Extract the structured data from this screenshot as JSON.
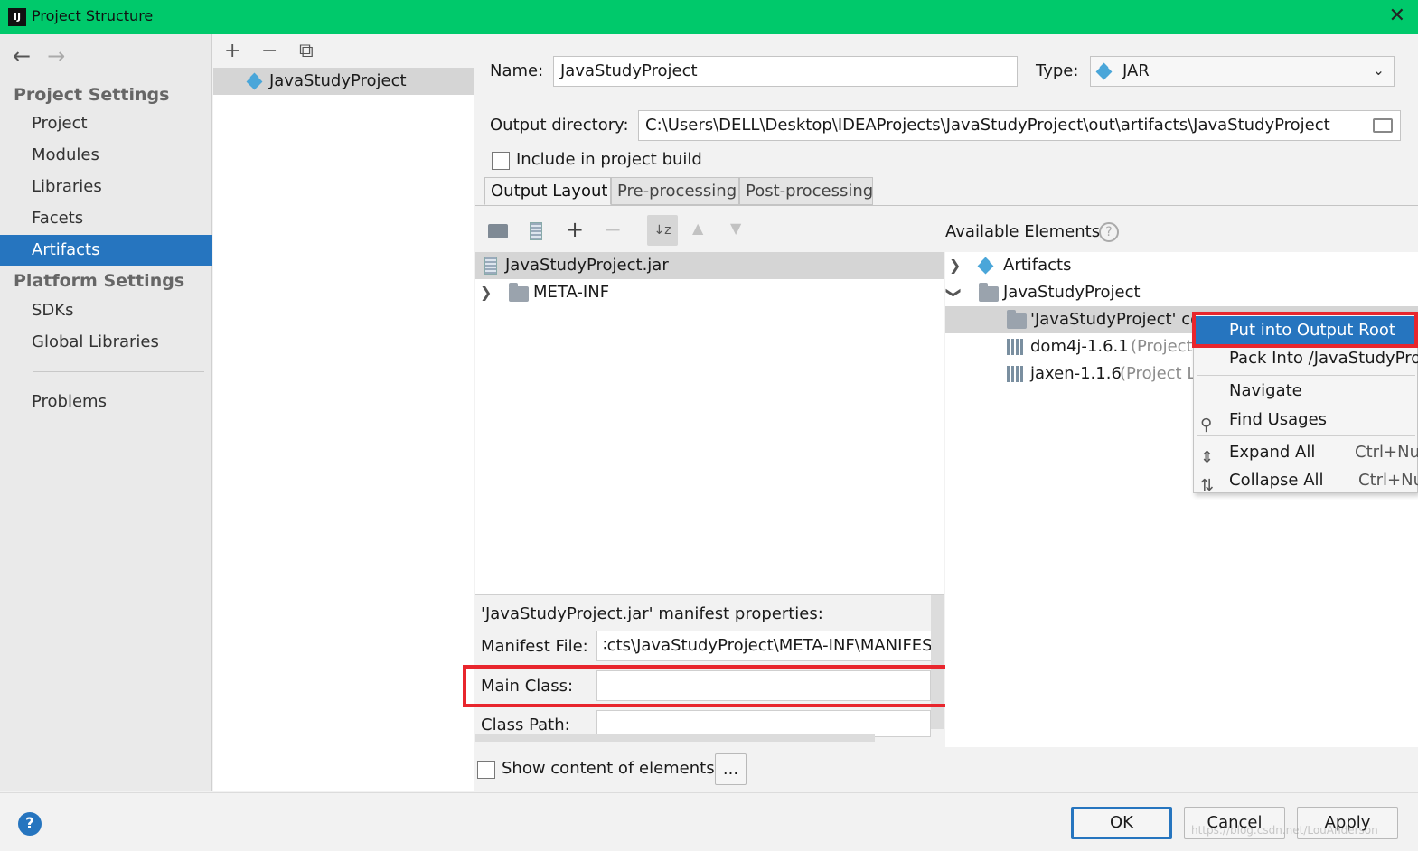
{
  "window": {
    "title": "Project Structure",
    "close_glyph": "✕",
    "app_icon": "IJ"
  },
  "nav": {
    "back": "←",
    "forward": "→"
  },
  "sidebar": {
    "project_settings_heading": "Project Settings",
    "project_items": [
      "Project",
      "Modules",
      "Libraries",
      "Facets",
      "Artifacts"
    ],
    "platform_settings_heading": "Platform Settings",
    "platform_items": [
      "SDKs",
      "Global Libraries"
    ],
    "problems": "Problems",
    "active_item": "Artifacts"
  },
  "artifact_list": {
    "toolbar": {
      "add": "+",
      "remove": "−",
      "copy": "⧉"
    },
    "items": [
      "JavaStudyProject"
    ]
  },
  "artifact": {
    "name_label": "Name:",
    "name_value": "JavaStudyProject",
    "type_label": "Type:",
    "type_value": "JAR",
    "output_dir_label": "Output directory:",
    "output_dir_value": "C:\\Users\\DELL\\Desktop\\IDEAProjects\\JavaStudyProject\\out\\artifacts\\JavaStudyProject",
    "include_build_label": "Include in project build",
    "include_build_checked": false
  },
  "tabs": [
    "Output Layout",
    "Pre-processing",
    "Post-processing"
  ],
  "active_tab": "Output Layout",
  "layout_tree": [
    {
      "label": "JavaStudyProject.jar",
      "kind": "jar"
    },
    {
      "label": "META-INF",
      "kind": "folder"
    }
  ],
  "manifest": {
    "header": "'JavaStudyProject.jar' manifest properties:",
    "manifest_file_label": "Manifest File:",
    "manifest_file_value": "∶cts\\JavaStudyProject\\META-INF\\MANIFEST.",
    "main_class_label": "Main Class:",
    "main_class_value": "",
    "class_path_label": "Class Path:",
    "class_path_value": ""
  },
  "show_content_label": "Show content of elements",
  "show_content_button": "...",
  "available": {
    "heading": "Available Elements",
    "tree": [
      {
        "label": "Artifacts"
      },
      {
        "label": "JavaStudyProject"
      },
      {
        "label": "'JavaStudyProject' co"
      },
      {
        "label": "dom4j-1.6.1",
        "suffix": "(Project"
      },
      {
        "label": "jaxen-1.1.6",
        "suffix": "(Project L"
      }
    ]
  },
  "context_menu": {
    "items": [
      {
        "label": "Put into Output Root",
        "shortcut": ""
      },
      {
        "label": "Pack Into /JavaStudyProj",
        "shortcut": ""
      },
      {
        "label": "Navigate",
        "shortcut": ""
      },
      {
        "label": "Find Usages",
        "shortcut": ""
      },
      {
        "label": "Expand All",
        "shortcut": "Ctrl+Nu"
      },
      {
        "label": "Collapse All",
        "shortcut": "Ctrl+Nu"
      }
    ],
    "highlighted": "Put into Output Root"
  },
  "buttons": {
    "ok": "OK",
    "cancel": "Cancel",
    "apply": "Apply",
    "help": "?"
  },
  "watermark": "https://blog.csdn.net/LouAnderson",
  "colors": {
    "titlebar": "#00c96b",
    "selection": "#2675bf",
    "highlight_box": "#e8262d"
  }
}
